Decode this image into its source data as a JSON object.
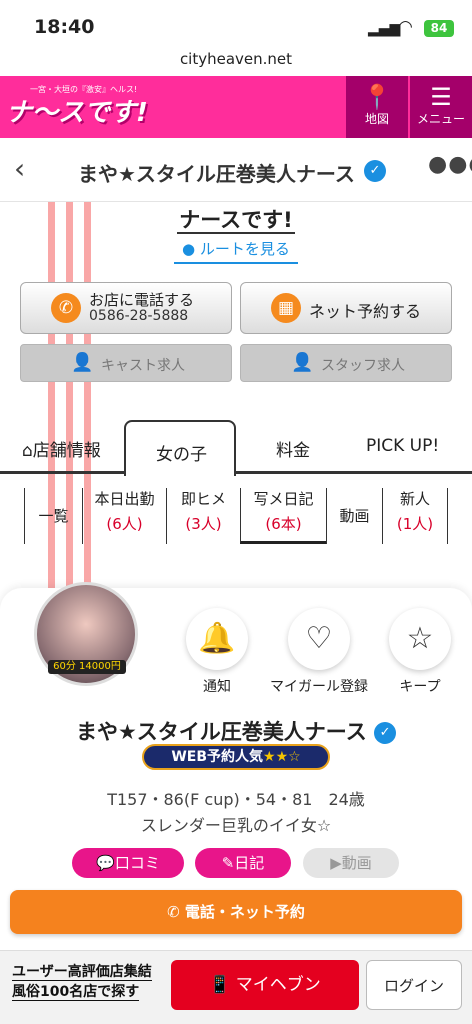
{
  "status": {
    "time": "18:40",
    "battery": "84",
    "url": "cityheaven.net"
  },
  "header": {
    "logo_text": "ナ〜スです!",
    "logo_sub": "一宮・大垣の『激安』ヘルス!",
    "map_label": "地図",
    "menu_label": "メニュー",
    "map_icon": "map-pin-icon",
    "menu_icon": "hamburger-icon"
  },
  "titlebar": {
    "title": "まや★スタイル圧巻美人ナース"
  },
  "shop": {
    "name": "ナースです!",
    "route_label": "ルートを見る",
    "call_label": "お店に電話する",
    "phone": "0586-28-5888",
    "reserve_label": "ネット予約する",
    "cast_recruit": "キャスト求人",
    "staff_recruit": "スタッフ求人"
  },
  "tabs": [
    {
      "label": "店舗情報"
    },
    {
      "label": "女の子"
    },
    {
      "label": "料金"
    },
    {
      "label": "PICK UP!"
    }
  ],
  "subtabs": [
    {
      "label": "一覧",
      "count": ""
    },
    {
      "label": "本日出勤",
      "count": "(6人)"
    },
    {
      "label": "即ヒメ",
      "count": "(3人)"
    },
    {
      "label": "写メ日記",
      "count": "(6本)"
    },
    {
      "label": "動画",
      "count": ""
    },
    {
      "label": "新人",
      "count": "(1人)"
    }
  ],
  "profile": {
    "avatar_label": "60分 14000円",
    "notify_label": "通知",
    "mygirl_label": "マイガール登録",
    "keep_label": "キープ",
    "name": "まや★スタイル圧巻美人ナース",
    "badge": "WEB予約人気",
    "badge_stars": "★★☆",
    "stats": "T157・86(F cup)・54・81　24歳",
    "catch": "スレンダー巨乳のイイ女☆",
    "review_label": "口コミ",
    "diary_label": "日記",
    "video_label": "動画"
  },
  "bottom": {
    "cta": "電話・ネット予約",
    "promo_line1": "ユーザー高評価店集結",
    "promo_line2": "風俗100名店で探す",
    "myheaven": "マイヘブン",
    "login": "ログイン"
  },
  "colors": {
    "brand_pink": "#ff2d9b",
    "header_dark": "#a4006a",
    "accent_orange": "#f5821e",
    "count_red": "#d8002a"
  }
}
